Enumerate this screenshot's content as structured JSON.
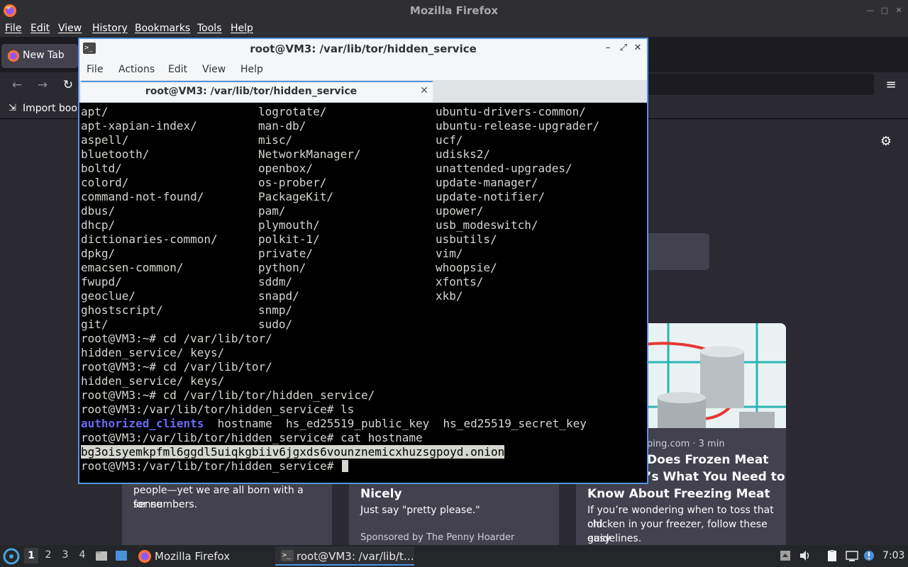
{
  "firefox": {
    "window_title": "Mozilla Firefox",
    "menus": [
      "File",
      "Edit",
      "View",
      "History",
      "Bookmarks",
      "Tools",
      "Help"
    ],
    "tab_label": "New Tab",
    "import_bookmarks_label": "Import book",
    "cards": {
      "card1_desc_1": "people—yet we are all born with a sense",
      "card1_desc_2": "for numbers.",
      "card2_title": "Nicely",
      "card2_desc": "Just say \"pretty please.\"",
      "card2_sponsor": "Sponsored by The Penny Hoarder",
      "card3_meta": "ping.com · 3 min",
      "card3_title_1": "Does Frozen Meat",
      "card3_title_2": "’s What You Need to",
      "card3_title_3": "Know About Freezing Meat",
      "card3_desc_1": "If you’re wondering when to toss that old",
      "card3_desc_2": "chicken in your freezer, follow these easy",
      "card3_desc_3": "guidelines."
    }
  },
  "terminal": {
    "window_title": "root@VM3: /var/lib/tor/hidden_service",
    "menus": [
      "File",
      "Actions",
      "Edit",
      "View",
      "Help"
    ],
    "tab_label": "root@VM3: /var/lib/tor/hidden_service",
    "dir_col1": [
      "apt/",
      "apt-xapian-index/",
      "aspell/",
      "bluetooth/",
      "boltd/",
      "colord/",
      "command-not-found/",
      "dbus/",
      "dhcp/",
      "dictionaries-common/",
      "dpkg/",
      "emacsen-common/",
      "fwupd/",
      "geoclue/",
      "ghostscript/",
      "git/"
    ],
    "dir_col2": [
      "logrotate/",
      "man-db/",
      "misc/",
      "NetworkManager/",
      "openbox/",
      "os-prober/",
      "PackageKit/",
      "pam/",
      "plymouth/",
      "polkit-1/",
      "private/",
      "python/",
      "sddm/",
      "snapd/",
      "snmp/",
      "sudo/"
    ],
    "dir_col3": [
      "ubuntu-drivers-common/",
      "ubuntu-release-upgrader/",
      "ucf/",
      "udisks2/",
      "unattended-upgrades/",
      "update-manager/",
      "update-notifier/",
      "upower/",
      "usb_modeswitch/",
      "usbutils/",
      "vim/",
      "whoopsie/",
      "xfonts/",
      "xkb/"
    ],
    "line_cd1": "root@VM3:~# cd /var/lib/tor/",
    "line_comp1": "hidden_service/ keys/",
    "line_cd2": "root@VM3:~# cd /var/lib/tor/",
    "line_comp2": "hidden_service/ keys/",
    "line_cd3": "root@VM3:~# cd /var/lib/tor/hidden_service/",
    "line_ls": "root@VM3:/var/lib/tor/hidden_service# ls",
    "ls_dir": "authorized_clients",
    "ls_files": "  hostname  hs_ed25519_public_key  hs_ed25519_secret_key",
    "line_cat": "root@VM3:/var/lib/tor/hidden_service# cat hostname",
    "onion": "bg3oisyemkpfml6ggdl5uiqkgbiiv6jgxds6vounznemicxhuzsgpoyd.onion",
    "prompt": "root@VM3:/var/lib/tor/hidden_service# "
  },
  "taskbar": {
    "workspaces": [
      "1",
      "2",
      "3",
      "4"
    ],
    "firefox_label": "Mozilla Firefox",
    "terminal_label": "root@VM3: /var/lib/t…",
    "clock": "7:03"
  }
}
